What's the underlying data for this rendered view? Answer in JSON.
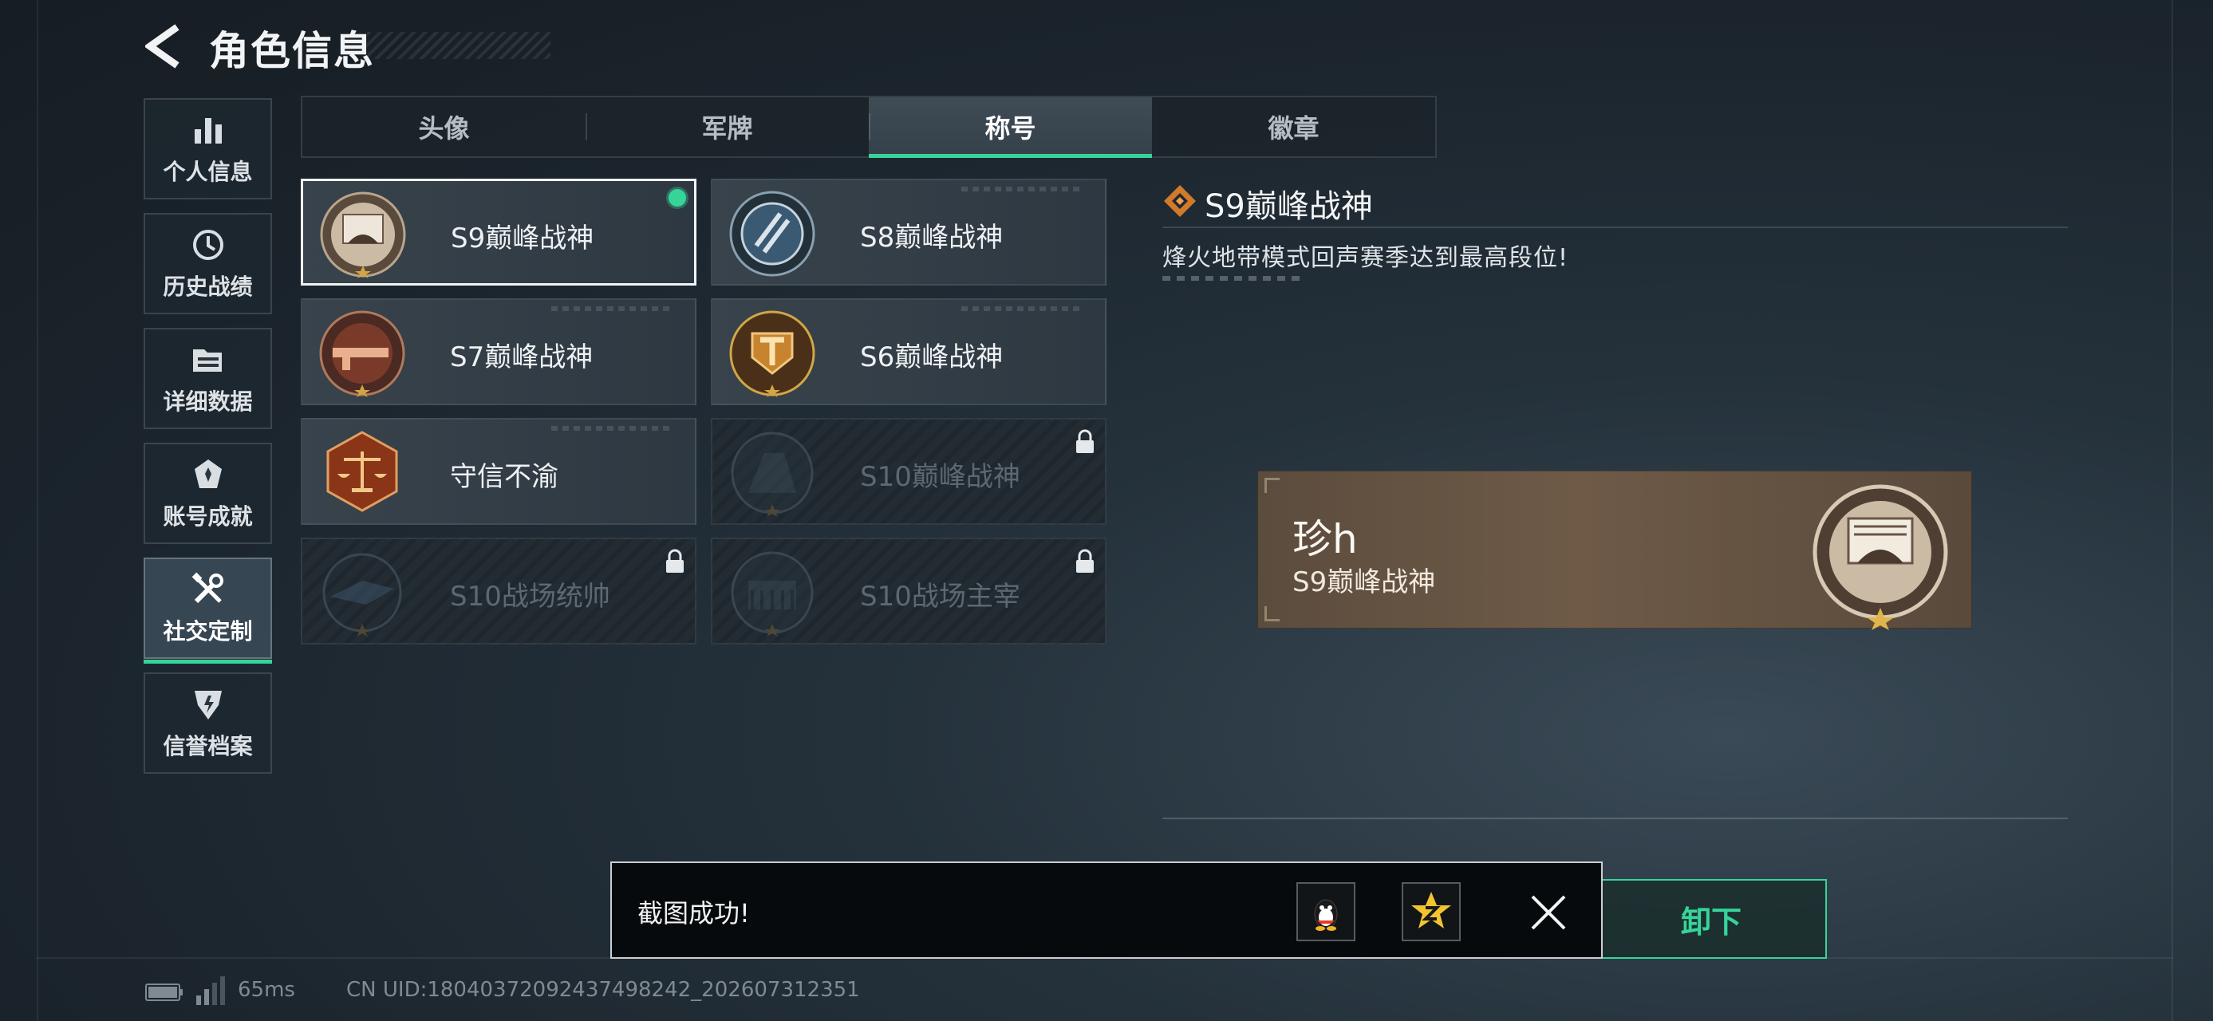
{
  "header": {
    "title": "角色信息"
  },
  "sidebar": {
    "items": [
      {
        "label": "个人信息",
        "icon": "bar-chart-icon"
      },
      {
        "label": "历史战绩",
        "icon": "history-clock-icon"
      },
      {
        "label": "详细数据",
        "icon": "folder-data-icon"
      },
      {
        "label": "账号成就",
        "icon": "achievement-icon"
      },
      {
        "label": "社交定制",
        "icon": "tools-icon",
        "active": true
      },
      {
        "label": "信誉档案",
        "icon": "credit-shield-icon"
      }
    ]
  },
  "tabs": [
    {
      "label": "头像"
    },
    {
      "label": "军牌"
    },
    {
      "label": "称号",
      "active": true
    },
    {
      "label": "徽章"
    }
  ],
  "titles": [
    {
      "name": "S9巅峰战神",
      "selected": true,
      "equipped": true,
      "locked": false
    },
    {
      "name": "S8巅峰战神",
      "locked": false
    },
    {
      "name": "S7巅峰战神",
      "locked": false
    },
    {
      "name": "S6巅峰战神",
      "locked": false
    },
    {
      "name": "守信不渝",
      "locked": false
    },
    {
      "name": "S10巅峰战神",
      "locked": true
    },
    {
      "name": "S10战场统帅",
      "locked": true
    },
    {
      "name": "S10战场主宰",
      "locked": true
    }
  ],
  "detail": {
    "title": "S9巅峰战神",
    "description": "烽火地带模式回声赛季达到最高段位!"
  },
  "preview": {
    "player_name": "珍h",
    "title": "S9巅峰战神"
  },
  "action": {
    "button_label": "卸下"
  },
  "toast": {
    "message": "截图成功!"
  },
  "status": {
    "ping": "65ms",
    "uid": "CN UID:18040372092437498242_202607312351"
  },
  "colors": {
    "accent": "#37d49a",
    "background": "#1b242c",
    "plate": "#6e5a47",
    "medal_gold": "#d2a647"
  }
}
